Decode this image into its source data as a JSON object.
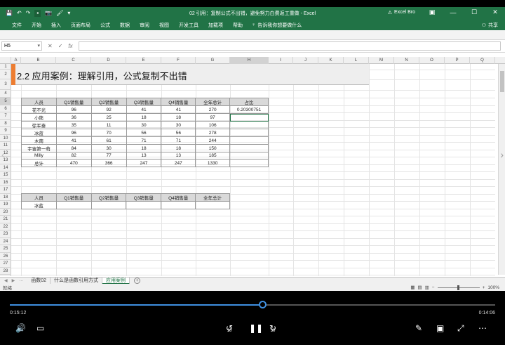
{
  "window": {
    "title": "02 引用：复制公式不出错，避免努力白费返工重做 - Excel",
    "user": "Excel Bro",
    "minimize": "—",
    "restore": "☐",
    "close": "✕"
  },
  "quick_access": [
    "💾",
    "↶",
    "↷",
    "▪",
    "📷",
    "🖌",
    "▾"
  ],
  "ribbon": {
    "tabs": [
      "文件",
      "开始",
      "插入",
      "页面布局",
      "公式",
      "数据",
      "审阅",
      "视图",
      "开发工具",
      "加载项",
      "帮助"
    ],
    "tell_me": "告诉我你想要做什么",
    "share": "共享"
  },
  "formula_bar": {
    "name_box": "H5",
    "cancel": "✕",
    "enter": "✓",
    "fx": "fx",
    "formula": ""
  },
  "columns": [
    "A",
    "B",
    "C",
    "D",
    "E",
    "F",
    "G",
    "H",
    "I",
    "J",
    "K",
    "L",
    "M",
    "N",
    "O",
    "P",
    "Q"
  ],
  "rows": [
    "1",
    "2",
    "3",
    "4",
    "5",
    "6",
    "7",
    "8",
    "9",
    "10",
    "11",
    "12",
    "13",
    "14",
    "15",
    "16",
    "17",
    "18",
    "19",
    "20",
    "21",
    "22",
    "23",
    "24",
    "25",
    "26",
    "27",
    "28"
  ],
  "banner_title": "2.2  应用案例：理解引用，公式复制不出错",
  "table1": {
    "headers": [
      "人员",
      "Q1销售量",
      "Q2销售量",
      "Q3销售量",
      "Q4销售量",
      "全年总计",
      "占比"
    ],
    "rows": [
      [
        "花不光",
        "96",
        "92",
        "41",
        "41",
        "270",
        "0.20300751"
      ],
      [
        "小熊",
        "36",
        "25",
        "18",
        "18",
        "97",
        ""
      ],
      [
        "徐军泰",
        "35",
        "11",
        "30",
        "30",
        "106",
        ""
      ],
      [
        "冰蓝",
        "96",
        "70",
        "56",
        "56",
        "278",
        ""
      ],
      [
        "木南",
        "41",
        "61",
        "71",
        "71",
        "244",
        ""
      ],
      [
        "宇宙第一萌",
        "84",
        "30",
        "18",
        "18",
        "150",
        ""
      ],
      [
        "Milly",
        "82",
        "77",
        "13",
        "13",
        "185",
        ""
      ],
      [
        "总计",
        "470",
        "366",
        "247",
        "247",
        "1330",
        ""
      ]
    ]
  },
  "table2": {
    "headers": [
      "人员",
      "Q1销售量",
      "Q2销售量",
      "Q3销售量",
      "Q4销售量",
      "全年总计"
    ],
    "rows": [
      [
        "冰蓝",
        "",
        "",
        "",
        "",
        ""
      ]
    ]
  },
  "sheet_tabs": [
    "函数02",
    "什么是函数引用方式",
    "应用案例"
  ],
  "active_sheet": "应用案例",
  "status": {
    "ready": "就绪",
    "zoom": "100%"
  },
  "player": {
    "current_time": "0:15:12",
    "total_time": "0:14:06",
    "progress": 0.52,
    "skip_back": "10",
    "skip_fwd": "30"
  },
  "colors": {
    "excel_green": "#217346",
    "accent_orange": "#ed7d31",
    "progress_blue": "#3f8fe0"
  }
}
